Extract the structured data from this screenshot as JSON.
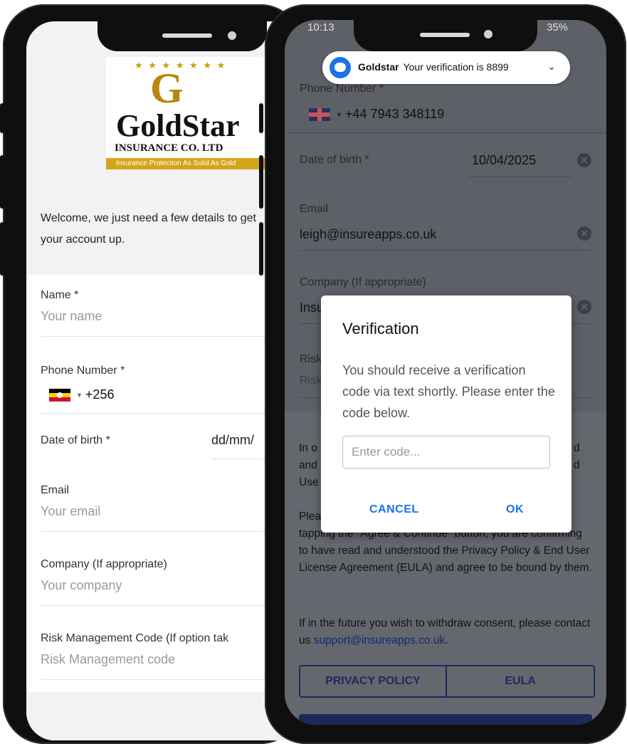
{
  "left_phone": {
    "logo": {
      "letter": "G",
      "brand": "GoldStar",
      "subtitle": "INSURANCE CO. LTD",
      "tagline": "Insurance Protection As Solid As Gold"
    },
    "welcome_text": "Welcome, we just need a few details to get your account up.",
    "fields": {
      "name_label": "Name *",
      "name_placeholder": "Your name",
      "phone_label": "Phone Number *",
      "phone_code": "+256",
      "dob_label": "Date of birth *",
      "dob_placeholder": "dd/mm/",
      "email_label": "Email",
      "email_placeholder": "Your email",
      "company_label": "Company (If appropriate)",
      "company_placeholder": "Your company",
      "risk_label": "Risk Management Code (If option tak",
      "risk_placeholder": "Risk Management code"
    },
    "flag": {
      "country": "Uganda"
    }
  },
  "right_phone": {
    "status_time": "10:13",
    "status_battery": "35%",
    "notification": {
      "app": "Goldstar",
      "message": "Your verification is 8899"
    },
    "fields": {
      "phone_label": "Phone Number *",
      "phone_value": "+44 7943 348119",
      "dob_label": "Date of birth *",
      "dob_value": "10/04/2025",
      "email_label": "Email",
      "email_value": "leigh@insureapps.co.uk",
      "company_label": "Company (If appropriate)",
      "company_value": "Insu",
      "risk_label": "Risk",
      "risk_placeholder": "Risk"
    },
    "consent": {
      "p1_start": "In o",
      "p1_end1": "d",
      "p1_mid": "and",
      "p1_end2": "d",
      "p1_last": "Use",
      "p2_start": "Plea",
      "p2": "tapping the \"Agree & Continue\" button, you are confirming to have read and understood the Privacy Policy & End User License Agreement (EULA) and agree to be bound by them.",
      "p3": "If in the future you wish to withdraw consent, please contact us",
      "p3_link": "support@insureapps.co.uk",
      "p3_end": "."
    },
    "buttons": {
      "privacy": "PRIVACY POLICY",
      "eula": "EULA"
    },
    "dialog": {
      "title": "Verification",
      "body": "You should receive a verification code via text shortly. Please enter the code below.",
      "input_placeholder": "Enter code...",
      "cancel": "CANCEL",
      "ok": "OK"
    }
  },
  "colors": {
    "gold": "#b8860b",
    "navy": "#1b2a5c",
    "link_blue": "#1a73e8"
  },
  "icons": [
    "uganda-flag-icon",
    "uk-flag-icon",
    "clear-icon",
    "goldstar-app-icon",
    "chevron-down-icon"
  ]
}
